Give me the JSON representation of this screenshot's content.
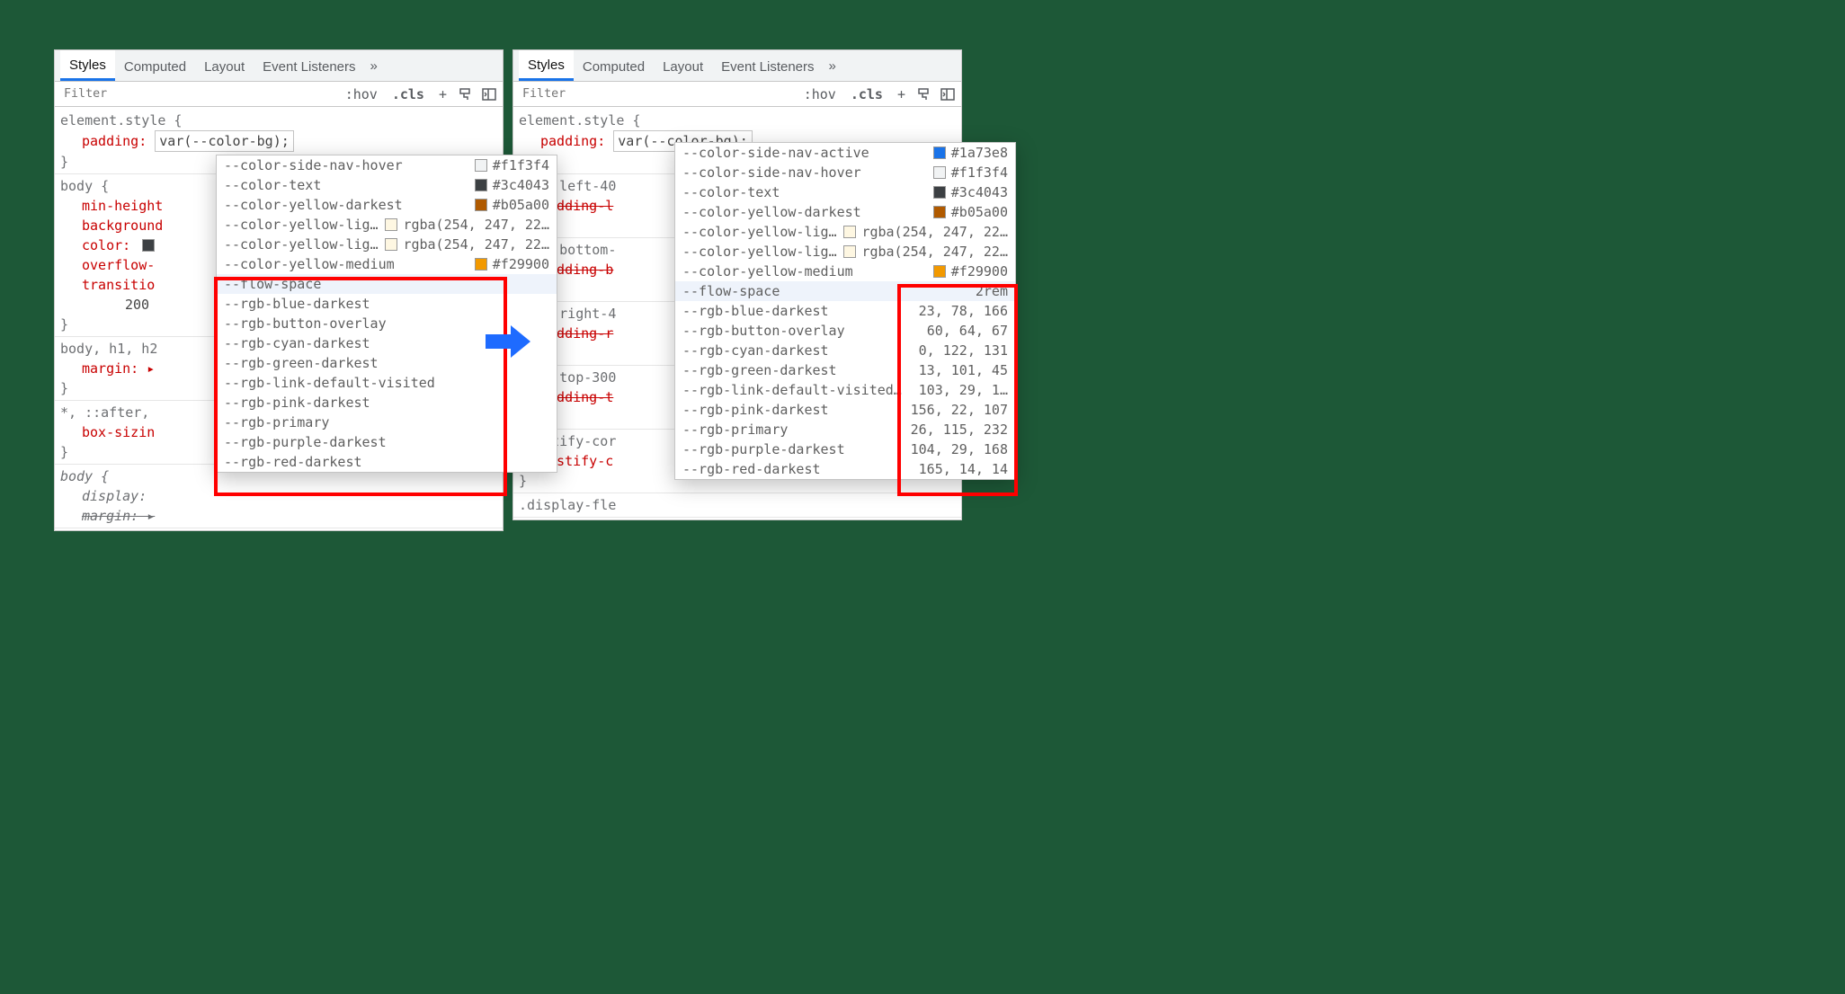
{
  "tabs": {
    "styles": "Styles",
    "computed": "Computed",
    "layout": "Layout",
    "listeners": "Event Listeners",
    "more": "»"
  },
  "filter": {
    "placeholder": "Filter",
    "hov": ":hov",
    "cls": ".cls",
    "plus": "+"
  },
  "left": {
    "es_open": "element.style {",
    "es_prop": "padding:",
    "es_val": "var(--color-bg);",
    "close": "}",
    "body_open": "body {",
    "body_props": {
      "min_h": "min-height",
      "bg": "background",
      "color": "color: ",
      "ov": "overflow-",
      "tr": "transitio",
      "tv": "200"
    },
    "bodyh_open": "body, h1, h2",
    "bodyh_margin": "margin: ▸",
    "star_open": "*, ::after,",
    "star_box": "box-sizin",
    "body2_open": "body {",
    "body2_display": "display:",
    "body2_margin": "margin: ▸"
  },
  "right": {
    "es_open": "element.style {",
    "es_prop": "padding:",
    "es_val": "var(--color-bg);",
    "pl_open": ".pad-left-40",
    "pl_prop": "padding-l",
    "pb_open": ".pad-bottom-",
    "pb_prop": "padding-b",
    "pr_open": ".pad-right-4",
    "pr_prop": "padding-r",
    "pt_open": ".pad-top-300",
    "pt_prop": "padding-t",
    "jc_open": ".justify-cor",
    "jc_prop": "justify-c",
    "df_open": ".display-fle",
    "close": "}"
  },
  "ac_color_rows": [
    {
      "name": "--color-side-nav-hover",
      "sw": "#f1f3f4",
      "val": "#f1f3f4"
    },
    {
      "name": "--color-text",
      "sw": "#3c4043",
      "val": "#3c4043"
    },
    {
      "name": "--color-yellow-darkest",
      "sw": "#b05a00",
      "val": "#b05a00"
    },
    {
      "name": "--color-yellow-lig…",
      "sw": "#fef7e2",
      "val": "rgba(254, 247, 22…"
    },
    {
      "name": "--color-yellow-ligh…",
      "sw": "#fef7e2",
      "val": "rgba(254, 247, 22…"
    },
    {
      "name": "--color-yellow-medium",
      "sw": "#f29900",
      "val": "#f29900"
    }
  ],
  "ac_color_rows_right_extra": {
    "name": "--color-side-nav-active",
    "sw": "#1a73e8",
    "val": "#1a73e8"
  },
  "ac_noval_rows": [
    "--flow-space",
    "--rgb-blue-darkest",
    "--rgb-button-overlay",
    "--rgb-cyan-darkest",
    "--rgb-green-darkest",
    "--rgb-link-default-visited",
    "--rgb-pink-darkest",
    "--rgb-primary",
    "--rgb-purple-darkest",
    "--rgb-red-darkest"
  ],
  "ac_val_rows": [
    {
      "name": "--flow-space",
      "val": "2rem"
    },
    {
      "name": "--rgb-blue-darkest",
      "val": "23, 78, 166"
    },
    {
      "name": "--rgb-button-overlay",
      "val": "60, 64, 67"
    },
    {
      "name": "--rgb-cyan-darkest",
      "val": "0, 122, 131"
    },
    {
      "name": "--rgb-green-darkest",
      "val": "13, 101, 45"
    },
    {
      "name": "--rgb-link-default-visited…",
      "val": "103, 29, 1…"
    },
    {
      "name": "--rgb-pink-darkest",
      "val": "156, 22, 107"
    },
    {
      "name": "--rgb-primary",
      "val": "26, 115, 232"
    },
    {
      "name": "--rgb-purple-darkest",
      "val": "104, 29, 168"
    },
    {
      "name": "--rgb-red-darkest",
      "val": "165, 14, 14"
    }
  ]
}
